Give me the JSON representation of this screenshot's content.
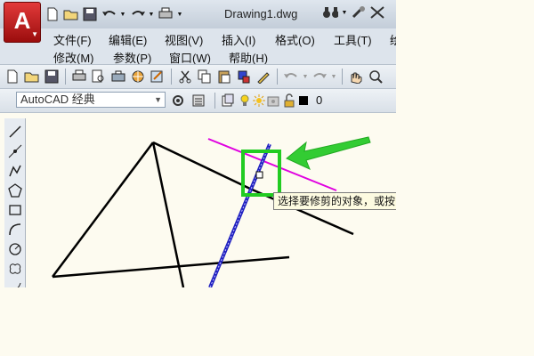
{
  "window": {
    "document_title": "Drawing1.dwg",
    "app_logo": "A"
  },
  "quick_access": {
    "icons": [
      "new-icon",
      "open-icon",
      "save-icon",
      "undo-icon",
      "redo-icon",
      "plot-icon"
    ]
  },
  "menu": {
    "items": [
      "文件(F)",
      "编辑(E)",
      "视图(V)",
      "插入(I)",
      "格式(O)",
      "工具(T)",
      "绘",
      "修改(M)",
      "参数(P)",
      "窗口(W)",
      "帮助(H)"
    ]
  },
  "toolbar2": {
    "workspace": "AutoCAD 经典",
    "layer_name": "0"
  },
  "tooltip": {
    "text": "选择要修剪的对象，或按"
  },
  "colors": {
    "canvas": "#fdfbf0",
    "lines": "#000000",
    "magenta_line": "#e000e0",
    "blue_line": "#2020c0",
    "highlight_box": "#22cc22",
    "arrow": "#33cc33"
  }
}
